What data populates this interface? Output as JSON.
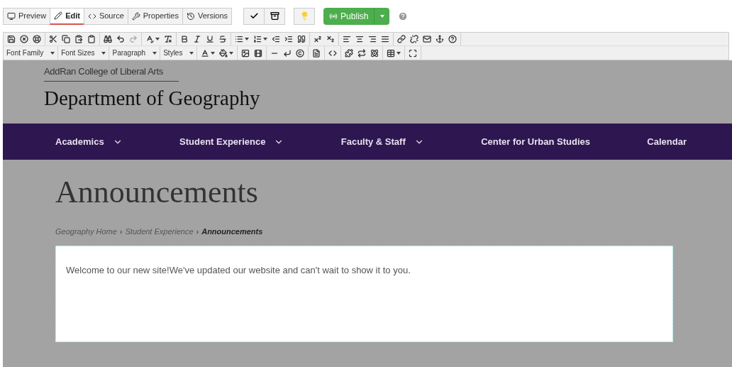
{
  "mode_tabs": [
    {
      "label": "Preview",
      "selected": false
    },
    {
      "label": "Edit",
      "selected": true
    },
    {
      "label": "Source",
      "selected": false
    },
    {
      "label": "Properties",
      "selected": false
    },
    {
      "label": "Versions",
      "selected": false
    }
  ],
  "publish": {
    "label": "Publish"
  },
  "editor_dropdowns": [
    {
      "label": "Font Family"
    },
    {
      "label": "Font Sizes"
    },
    {
      "label": "Paragraph"
    },
    {
      "label": "Styles"
    }
  ],
  "site": {
    "college": "AddRan College of Liberal Arts",
    "department": "Department of Geography"
  },
  "nav": [
    {
      "label": "Academics",
      "dropdown": true
    },
    {
      "label": "Student Experience",
      "dropdown": true
    },
    {
      "label": "Faculty & Staff",
      "dropdown": true
    },
    {
      "label": "Center for Urban Studies",
      "dropdown": false
    },
    {
      "label": "Calendar",
      "dropdown": false
    }
  ],
  "page_title": "Announcements",
  "breadcrumb": {
    "separator": "›",
    "items": [
      {
        "label": "Geography Home",
        "current": false
      },
      {
        "label": "Student Experience",
        "current": false
      },
      {
        "label": "Announcements",
        "current": true
      }
    ]
  },
  "content": "Welcome to our new site!We've updated our website and can't wait to show it to you."
}
